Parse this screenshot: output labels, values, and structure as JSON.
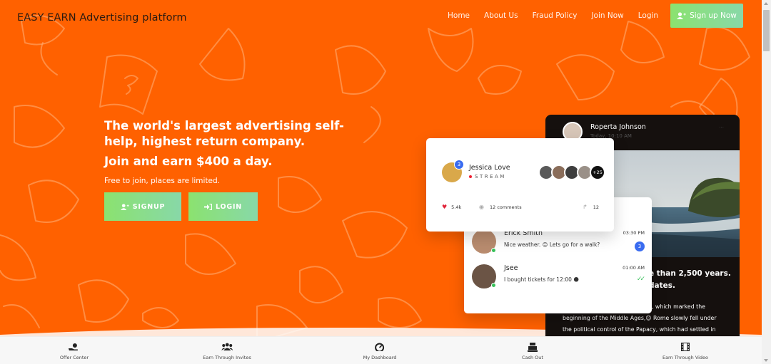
{
  "header": {
    "brand": "EASY EARN Advertising platform",
    "nav": [
      "Home",
      "About Us",
      "Fraud Policy",
      "Join Now",
      "Login"
    ],
    "signup_label": "Sign up Now",
    "signup_icon": "user-plus-icon"
  },
  "hero": {
    "headline": "The world's largest advertising self-help, highest return company.",
    "earn": "Join and earn $400 a day.",
    "sub": "Free to join, places are limited.",
    "signup_label": "SIGNUP",
    "login_label": "LOGIN"
  },
  "post_card": {
    "name": "Jessica Love",
    "badge": "3",
    "stream": "STREAM",
    "group_more": "+25",
    "likes": "5.4k",
    "comments": "12 comments",
    "shares": "12"
  },
  "dark_card": {
    "author": "Roperta Johnson",
    "meta": "Today, 10:10 AM",
    "more": "···",
    "title_lines": [
      "e than 2,500 years.",
      "dates."
    ],
    "body_lines": [
      "pire, which marked the",
      "beginning of the Middle Ages,😊 Rome slowly fell under",
      "the political control of the Papacy, which had settled in"
    ]
  },
  "chat": [
    {
      "name": "Erick Smith",
      "message": "Nice weather. 😊 Lets go for a walk?",
      "time": "03:30 PM",
      "unread": "3"
    },
    {
      "name": "Jsee",
      "message": "I bought tickets for 12:00 🌑",
      "time": "01:00 AM",
      "read_mark": "✓✓"
    }
  ],
  "bottom_nav": [
    {
      "label": "Offer Center",
      "icon": "hand-coin-icon"
    },
    {
      "label": "Earn Through Invites",
      "icon": "users-icon"
    },
    {
      "label": "My Dashboard",
      "icon": "gauge-icon"
    },
    {
      "label": "Cash Out",
      "icon": "cash-register-icon"
    },
    {
      "label": "Earn Through Video",
      "icon": "film-icon"
    }
  ],
  "colors": {
    "background": "#ff6100",
    "button_gradient_start": "#8be26f",
    "button_gradient_end": "#88d8a8",
    "badge_blue": "#3a6cf0",
    "online_green": "#37c15a"
  }
}
